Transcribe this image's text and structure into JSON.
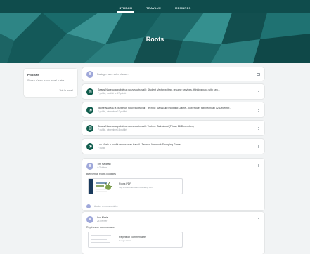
{
  "nav": {
    "tabs": [
      {
        "label": "STREAM",
        "active": true
      },
      {
        "label": "TRAVAUX",
        "active": false
      },
      {
        "label": "MEMBRES",
        "active": false
      }
    ]
  },
  "banner": {
    "title": "Roots",
    "color": "#1a6b6b"
  },
  "sidebar": {
    "heading": "Prochain",
    "text": "Si vous n'avez aucun travail à faire",
    "link": "Voir le travail"
  },
  "share": {
    "placeholder": "Partager avec votre classe..."
  },
  "stream_items": [
    {
      "icon": "assignment-icon",
      "title": "Seaus Nadeau a publié un nouveau travail : Student Vector writing, resume services, thinking para with sen...",
      "sub": "7 publié, modifié le 17 publié"
    },
    {
      "icon": "camera-icon",
      "title": "Janne Nadeau a publié un nouveau travail : Techno: Nabaouk Shopping Game - Tower over tab (Monday 12 Décembr...",
      "sub": "7 publié, décembre 12 publié"
    },
    {
      "icon": "assignment-icon",
      "title": "Seaus Nadeau a publié un nouveau travail : Techno: Talk about (Friday 16 December)",
      "sub": "7 publié, décembre 16 publié"
    },
    {
      "icon": "camera-icon",
      "title": "Lux Marie a publié un nouveau travail : Techno: Nabaouk Shopping Game",
      "sub": "7 publié"
    }
  ],
  "posts": [
    {
      "author": "Tim Nadeau",
      "date": "4 Octobre",
      "text": "Bienvenue Roots Modules",
      "attachment": {
        "title": "Roots PDF",
        "url": "http://rootmodules.2016-exampl.com"
      },
      "comment": "Ajouter un commentaire"
    },
    {
      "author": "Lux Marie",
      "date": "24 Février",
      "text": "Répétez ce commentaire",
      "attachment": {
        "title": "Répétition commentaire",
        "url": "Google Docs"
      }
    }
  ],
  "colors": {
    "topbar": "#0f4c4c",
    "accent": "#0f5c4c",
    "background": "#f1f3f4"
  }
}
